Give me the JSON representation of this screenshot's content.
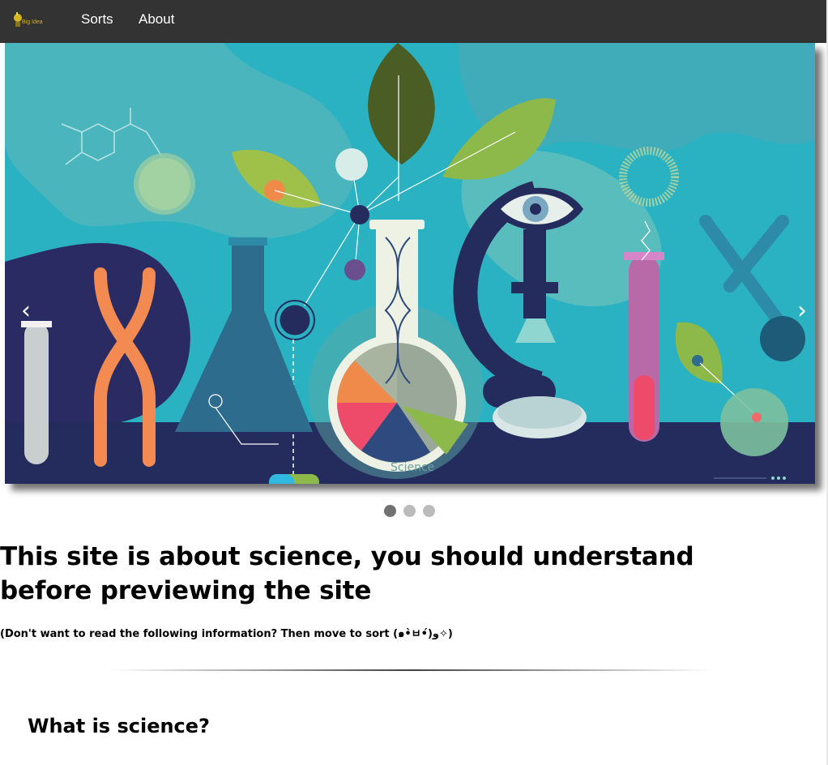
{
  "navbar": {
    "logo_text": "Big Idea",
    "links": [
      {
        "label": "Sorts"
      },
      {
        "label": "About"
      }
    ]
  },
  "carousel": {
    "prev_label": "‹",
    "next_label": "›",
    "image_caption": "Science",
    "slide_count": 3,
    "active_slide": 1
  },
  "content": {
    "headline": "This site is about science, you should understand before previewing the site",
    "subnote": "(Don't want to read the following information? Then move to sort   (๑•̀ㅂ•́)و✧)",
    "section_title": "What is science?"
  },
  "colors": {
    "navbar_bg": "#333333",
    "carousel_bg": "#2bb2c2",
    "dot_active": "#717171",
    "dot_inactive": "#bbbbbb"
  }
}
